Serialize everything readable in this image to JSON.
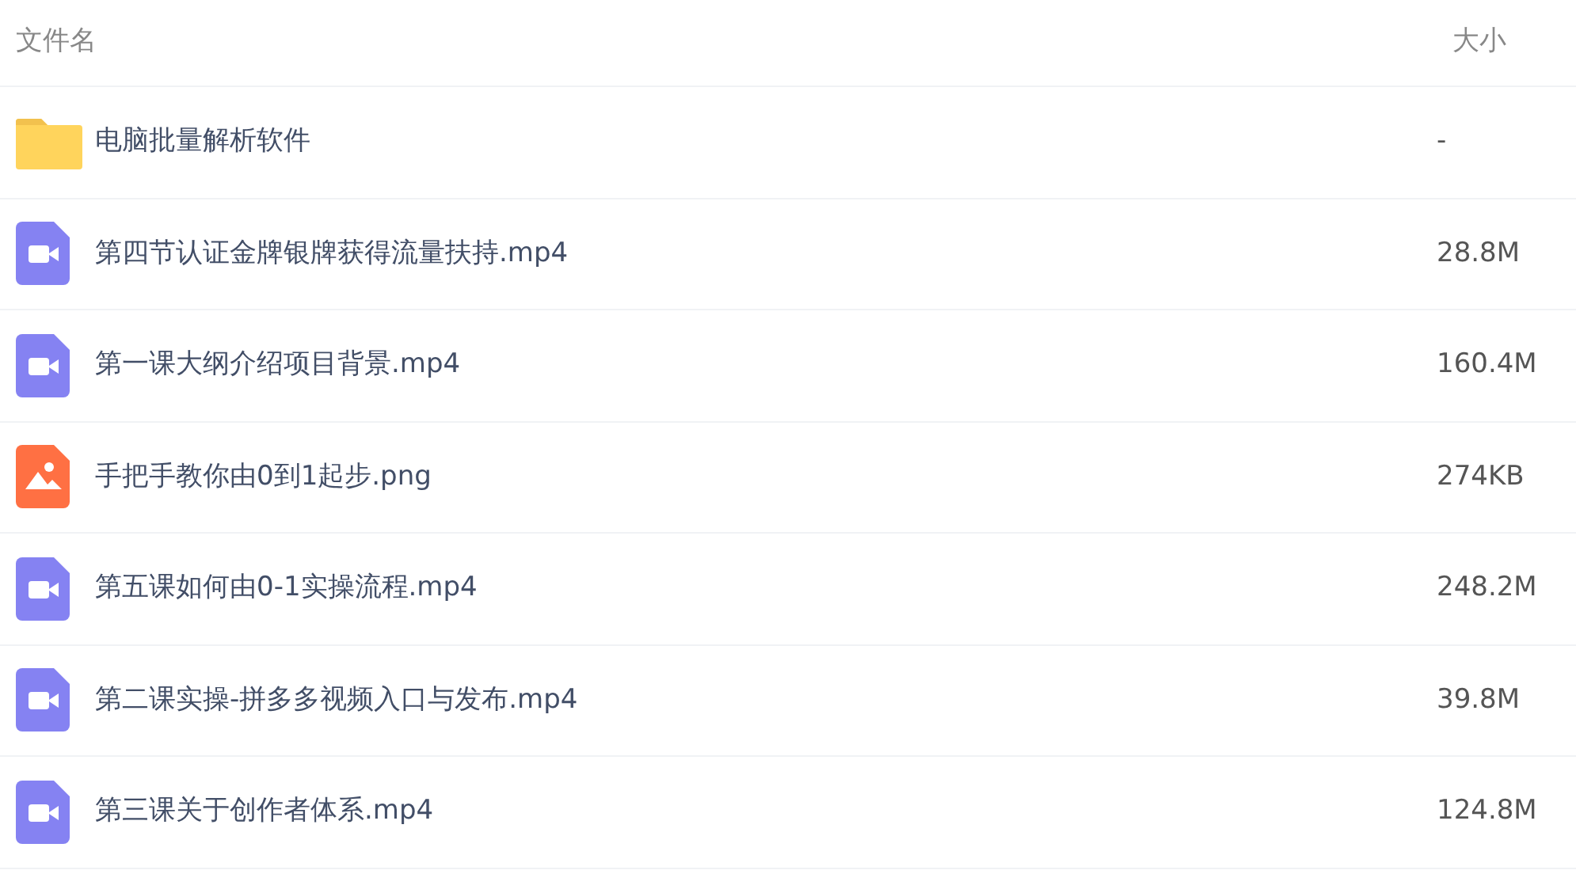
{
  "table": {
    "columns": [
      "文件名",
      "大小"
    ],
    "rows": [
      {
        "kind": "folder",
        "name": "电脑批量解析软件",
        "size": "-"
      },
      {
        "kind": "video",
        "name": "第四节认证金牌银牌获得流量扶持.mp4",
        "size": "28.8M"
      },
      {
        "kind": "video",
        "name": "第一课大纲介绍项目背景.mp4",
        "size": "160.4M"
      },
      {
        "kind": "image",
        "name": "手把手教你由0到1起步.png",
        "size": "274KB"
      },
      {
        "kind": "video",
        "name": "第五课如何由0-1实操流程.mp4",
        "size": "248.2M"
      },
      {
        "kind": "video",
        "name": "第二课实操-拼多多视频入口与发布.mp4",
        "size": "39.8M"
      },
      {
        "kind": "video",
        "name": "第三课关于创作者体系.mp4",
        "size": "124.8M"
      }
    ]
  }
}
